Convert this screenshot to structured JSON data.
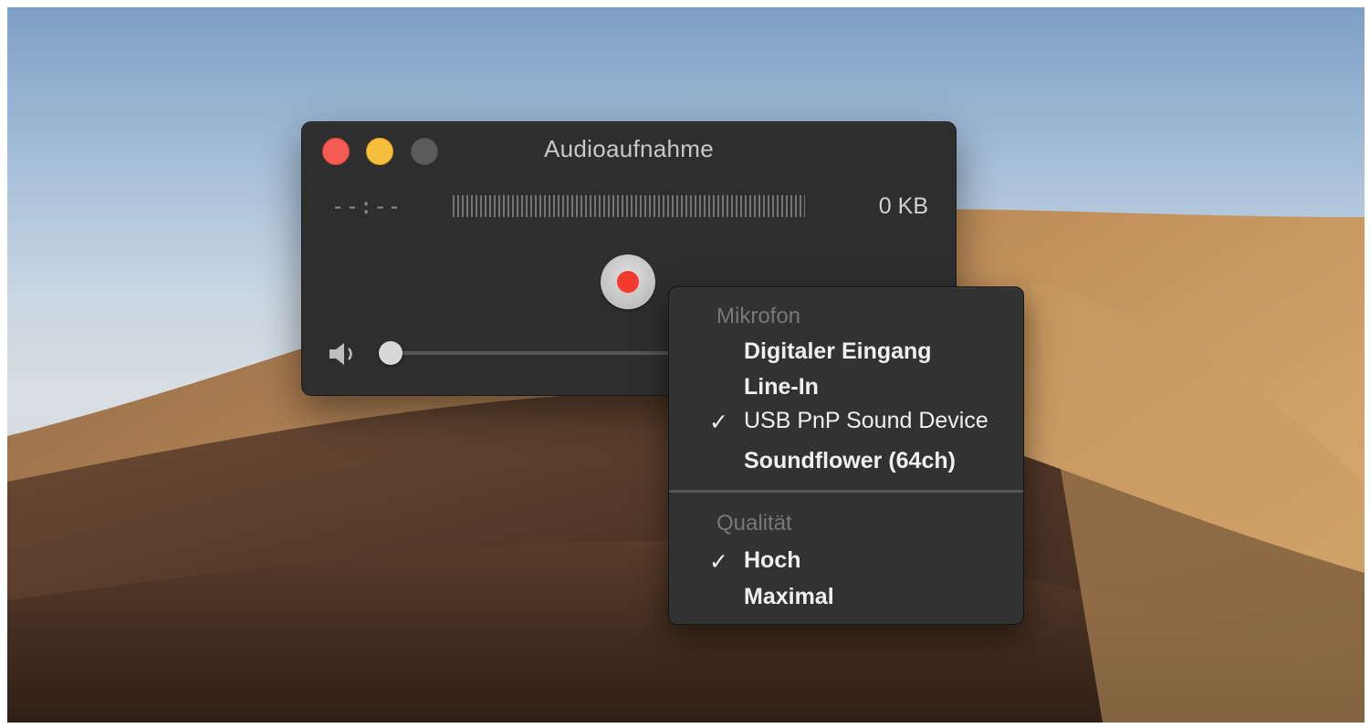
{
  "window": {
    "title": "Audioaufnahme",
    "time_display": "--:--",
    "file_size": "0 KB",
    "colors": {
      "close": "#f45b55",
      "minimize": "#f6bf3b",
      "zoom": "#5b5b5b",
      "record": "#f33a2e"
    },
    "volume_level": 0.0
  },
  "menu": {
    "microphone_header": "Mikrofon",
    "microphone_items": [
      {
        "label": "Digitaler Eingang",
        "checked": false
      },
      {
        "label": "Line-In",
        "checked": false
      },
      {
        "label": "USB PnP Sound Device",
        "checked": true
      },
      {
        "label": "Soundflower (64ch)",
        "checked": false
      }
    ],
    "quality_header": "Qualität",
    "quality_items": [
      {
        "label": "Hoch",
        "checked": true
      },
      {
        "label": "Maximal",
        "checked": false
      }
    ],
    "checkmark_glyph": "✓"
  },
  "icons": {
    "speaker": "speaker-icon",
    "record": "record-icon"
  }
}
